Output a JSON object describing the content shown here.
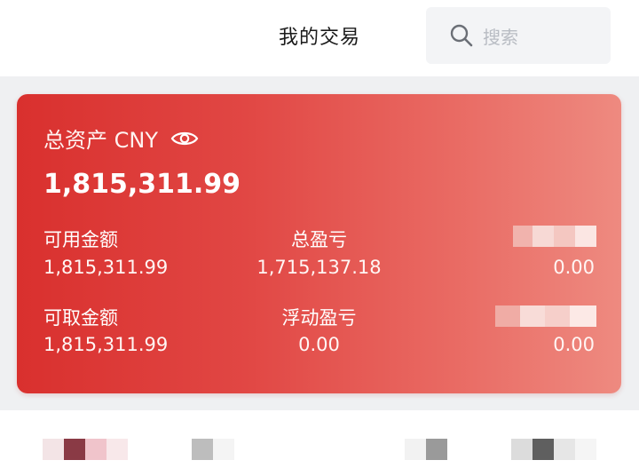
{
  "header": {
    "title": "我的交易",
    "search_placeholder": "搜索"
  },
  "asset_card": {
    "title": "总资产 CNY",
    "total_assets": "1,815,311.99",
    "available": {
      "label": "可用金额",
      "value": "1,815,311.99"
    },
    "total_pnl": {
      "label": "总盈亏",
      "value": "1,715,137.18"
    },
    "col3_row1": {
      "value": "0.00"
    },
    "withdrawable": {
      "label": "可取金额",
      "value": "1,815,311.99"
    },
    "floating_pnl": {
      "label": "浮动盈亏",
      "value": "0.00"
    },
    "col3_row2": {
      "value": "0.00"
    }
  },
  "colors": {
    "card_gradient_start": "#d9302e",
    "card_gradient_end": "#ee8a80",
    "search_bg": "#f3f4f6",
    "band_bg": "#eff0f2"
  },
  "icons": {
    "search": "search-icon",
    "eye": "eye-icon"
  }
}
